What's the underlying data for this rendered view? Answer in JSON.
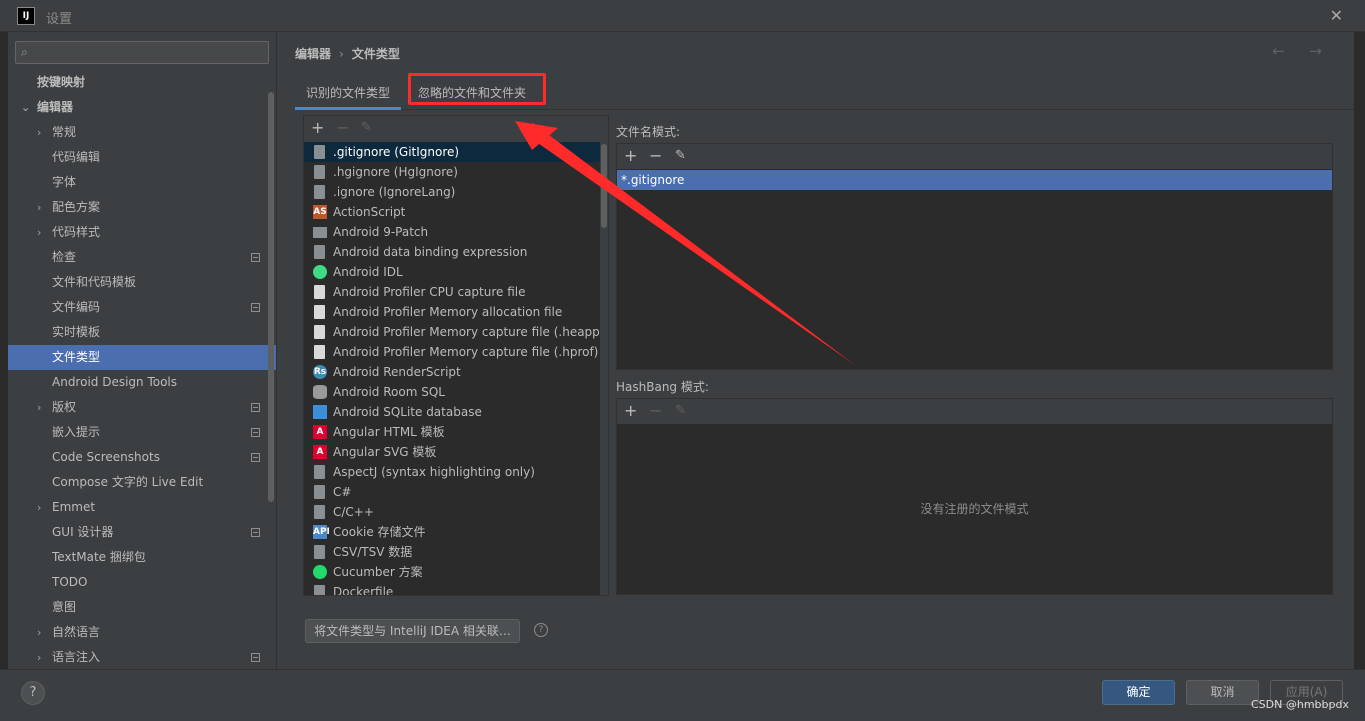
{
  "window": {
    "title": "设置",
    "logo": "IJ"
  },
  "sidebar": {
    "items": [
      {
        "label": "按键映射",
        "level": 0,
        "chevron": "",
        "bold": true,
        "badge": false,
        "selected": false
      },
      {
        "label": "编辑器",
        "level": 0,
        "chevron": "open",
        "bold": true,
        "badge": false,
        "selected": false
      },
      {
        "label": "常规",
        "level": 1,
        "chevron": "closed",
        "bold": false,
        "badge": false,
        "selected": false
      },
      {
        "label": "代码编辑",
        "level": 1,
        "chevron": "",
        "bold": false,
        "badge": false,
        "selected": false
      },
      {
        "label": "字体",
        "level": 1,
        "chevron": "",
        "bold": false,
        "badge": false,
        "selected": false
      },
      {
        "label": "配色方案",
        "level": 1,
        "chevron": "closed",
        "bold": false,
        "badge": false,
        "selected": false
      },
      {
        "label": "代码样式",
        "level": 1,
        "chevron": "closed",
        "bold": false,
        "badge": false,
        "selected": false
      },
      {
        "label": "检查",
        "level": 1,
        "chevron": "",
        "bold": false,
        "badge": true,
        "selected": false
      },
      {
        "label": "文件和代码模板",
        "level": 1,
        "chevron": "",
        "bold": false,
        "badge": false,
        "selected": false
      },
      {
        "label": "文件编码",
        "level": 1,
        "chevron": "",
        "bold": false,
        "badge": true,
        "selected": false
      },
      {
        "label": "实时模板",
        "level": 1,
        "chevron": "",
        "bold": false,
        "badge": false,
        "selected": false
      },
      {
        "label": "文件类型",
        "level": 1,
        "chevron": "",
        "bold": false,
        "badge": false,
        "selected": true
      },
      {
        "label": "Android Design Tools",
        "level": 1,
        "chevron": "",
        "bold": false,
        "badge": false,
        "selected": false
      },
      {
        "label": "版权",
        "level": 1,
        "chevron": "closed",
        "bold": false,
        "badge": true,
        "selected": false
      },
      {
        "label": "嵌入提示",
        "level": 1,
        "chevron": "",
        "bold": false,
        "badge": true,
        "selected": false
      },
      {
        "label": "Code Screenshots",
        "level": 1,
        "chevron": "",
        "bold": false,
        "badge": true,
        "selected": false
      },
      {
        "label": "Compose 文字的 Live Edit",
        "level": 1,
        "chevron": "",
        "bold": false,
        "badge": false,
        "selected": false
      },
      {
        "label": "Emmet",
        "level": 1,
        "chevron": "closed",
        "bold": false,
        "badge": false,
        "selected": false
      },
      {
        "label": "GUI 设计器",
        "level": 1,
        "chevron": "",
        "bold": false,
        "badge": true,
        "selected": false
      },
      {
        "label": "TextMate 捆绑包",
        "level": 1,
        "chevron": "",
        "bold": false,
        "badge": false,
        "selected": false
      },
      {
        "label": "TODO",
        "level": 1,
        "chevron": "",
        "bold": false,
        "badge": false,
        "selected": false
      },
      {
        "label": "意图",
        "level": 1,
        "chevron": "",
        "bold": false,
        "badge": false,
        "selected": false
      },
      {
        "label": "自然语言",
        "level": 1,
        "chevron": "closed",
        "bold": false,
        "badge": false,
        "selected": false
      },
      {
        "label": "语言注入",
        "level": 1,
        "chevron": "closed",
        "bold": false,
        "badge": true,
        "selected": false
      }
    ]
  },
  "breadcrumb": {
    "parent": "编辑器",
    "separator": "›",
    "current": "文件类型",
    "arrows": "← →"
  },
  "tabs": [
    {
      "label": "识别的文件类型",
      "active": true
    },
    {
      "label": "忽略的文件和文件夹",
      "active": false
    }
  ],
  "toolbar_glyphs": {
    "add": "+",
    "remove": "−",
    "edit": "✎"
  },
  "file_types": [
    {
      "label": ".gitignore (GitIgnore)",
      "icon": "file-icon",
      "color": "#8a8f94",
      "glyph": "",
      "selected": true
    },
    {
      "label": ".hgignore (HgIgnore)",
      "icon": "file-icon",
      "color": "#8a8f94",
      "glyph": "",
      "selected": false
    },
    {
      "label": ".ignore (IgnoreLang)",
      "icon": "file-icon",
      "color": "#8a8f94",
      "glyph": "",
      "selected": false
    },
    {
      "label": "ActionScript",
      "icon": "actionscript-icon",
      "color": "#c0562b",
      "glyph": "AS",
      "selected": false
    },
    {
      "label": "Android 9-Patch",
      "icon": "folder-icon",
      "color": "#8a8f94",
      "glyph": "",
      "selected": false
    },
    {
      "label": "Android data binding expression",
      "icon": "file-icon",
      "color": "#8a8f94",
      "glyph": "",
      "selected": false
    },
    {
      "label": "Android IDL",
      "icon": "android-icon",
      "color": "#3ddc84",
      "glyph": "",
      "selected": false
    },
    {
      "label": "Android Profiler CPU capture file",
      "icon": "profiler-file-icon",
      "color": "#d9d9d9",
      "glyph": "",
      "selected": false
    },
    {
      "label": "Android Profiler Memory allocation file",
      "icon": "profiler-file-icon",
      "color": "#d9d9d9",
      "glyph": "",
      "selected": false
    },
    {
      "label": "Android Profiler Memory capture file (.heapprofd)",
      "icon": "profiler-file-icon",
      "color": "#d9d9d9",
      "glyph": "",
      "selected": false
    },
    {
      "label": "Android Profiler Memory capture file (.hprof)",
      "icon": "profiler-file-icon",
      "color": "#d9d9d9",
      "glyph": "",
      "selected": false
    },
    {
      "label": "Android RenderScript",
      "icon": "renderscript-icon",
      "color": "#3d8bb0",
      "glyph": "Rs",
      "selected": false
    },
    {
      "label": "Android Room SQL",
      "icon": "database-icon",
      "color": "#9a9a9a",
      "glyph": "",
      "selected": false
    },
    {
      "label": "Android SQLite database",
      "icon": "sqlite-icon",
      "color": "#3a8fd6",
      "glyph": "",
      "selected": false
    },
    {
      "label": "Angular HTML 模板",
      "icon": "angular-icon",
      "color": "#dd0031",
      "glyph": "A",
      "selected": false
    },
    {
      "label": "Angular SVG 模板",
      "icon": "angular-icon",
      "color": "#dd0031",
      "glyph": "A",
      "selected": false
    },
    {
      "label": "AspectJ (syntax highlighting only)",
      "icon": "file-icon",
      "color": "#8a8f94",
      "glyph": "",
      "selected": false
    },
    {
      "label": "C#",
      "icon": "file-icon",
      "color": "#8a8f94",
      "glyph": "",
      "selected": false
    },
    {
      "label": "C/C++",
      "icon": "file-icon",
      "color": "#8a8f94",
      "glyph": "",
      "selected": false
    },
    {
      "label": "Cookie 存储文件",
      "icon": "api-file-icon",
      "color": "#4a88c7",
      "glyph": "API",
      "selected": false
    },
    {
      "label": "CSV/TSV 数据",
      "icon": "file-icon",
      "color": "#8a8f94",
      "glyph": "",
      "selected": false
    },
    {
      "label": "Cucumber 方案",
      "icon": "cucumber-icon",
      "color": "#23d96c",
      "glyph": "",
      "selected": false
    },
    {
      "label": "Dockerfile",
      "icon": "file-icon",
      "color": "#8a8f94",
      "glyph": "",
      "selected": false
    }
  ],
  "filename_patterns": {
    "label": "文件名模式:",
    "items": [
      "*.gitignore"
    ]
  },
  "hashbang_patterns": {
    "label": "HashBang 模式:",
    "empty_text": "没有注册的文件模式"
  },
  "associate_button": "将文件类型与 IntelliJ IDEA 相关联…",
  "help_small": "?",
  "footer": {
    "help": "?",
    "ok": "确定",
    "cancel": "取消",
    "apply": "应用(A)",
    "watermark": "CSDN @hmbbpdx"
  },
  "annotation_color": "#ff2a2a"
}
